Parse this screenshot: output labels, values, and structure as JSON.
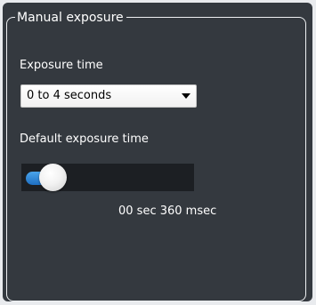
{
  "group": {
    "title": "Manual exposure"
  },
  "exposure_time": {
    "label": "Exposure time",
    "selected": "0 to 4 seconds"
  },
  "default_exposure": {
    "label": "Default exposure time",
    "readout": "00 sec 360 msec",
    "slider_fraction": 0.09
  },
  "colors": {
    "background": "#34393f",
    "slider_fill": "#2f86d8",
    "slider_track": "#1c1f23",
    "text": "#ffffff"
  }
}
